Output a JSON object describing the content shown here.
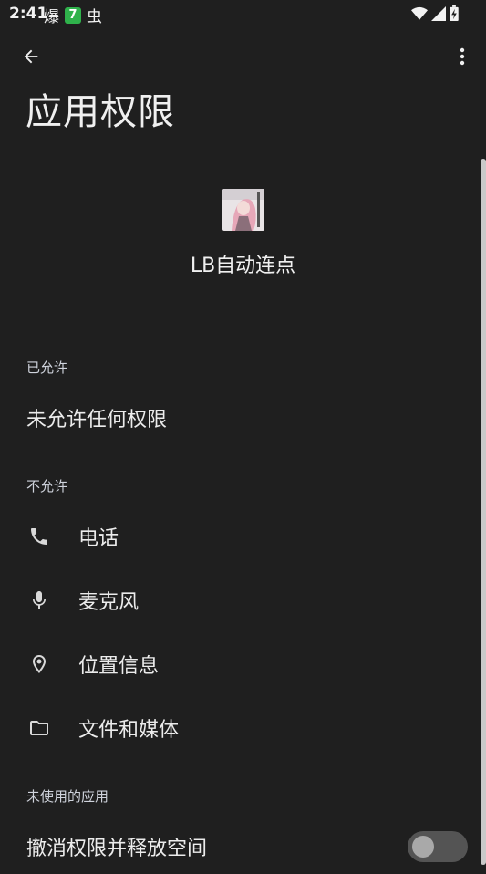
{
  "status_bar": {
    "time": "2:41",
    "icons_left": [
      "爆",
      "7",
      "虫"
    ],
    "icons_right": [
      "wifi-icon",
      "signal-icon",
      "battery-icon"
    ]
  },
  "app_bar": {
    "back_icon": "arrow-left-icon",
    "more_icon": "more-vert-icon"
  },
  "page": {
    "title": "应用权限"
  },
  "app": {
    "name": "LB自动连点"
  },
  "sections": {
    "allowed": {
      "label": "已允许",
      "empty_text": "未允许任何权限"
    },
    "denied": {
      "label": "不允许",
      "items": [
        {
          "label": "电话",
          "icon": "phone-icon"
        },
        {
          "label": "麦克风",
          "icon": "microphone-icon"
        },
        {
          "label": "位置信息",
          "icon": "location-pin-icon"
        },
        {
          "label": "文件和媒体",
          "icon": "folder-icon"
        }
      ]
    },
    "unused_apps": {
      "label": "未使用的应用",
      "toggle_label": "撤消权限并释放空间",
      "toggle_on": false
    }
  },
  "colors": {
    "background": "#1f1f1f",
    "text": "#ececec",
    "section_label": "#cfd3dc",
    "badge_green": "#2fb24b"
  }
}
